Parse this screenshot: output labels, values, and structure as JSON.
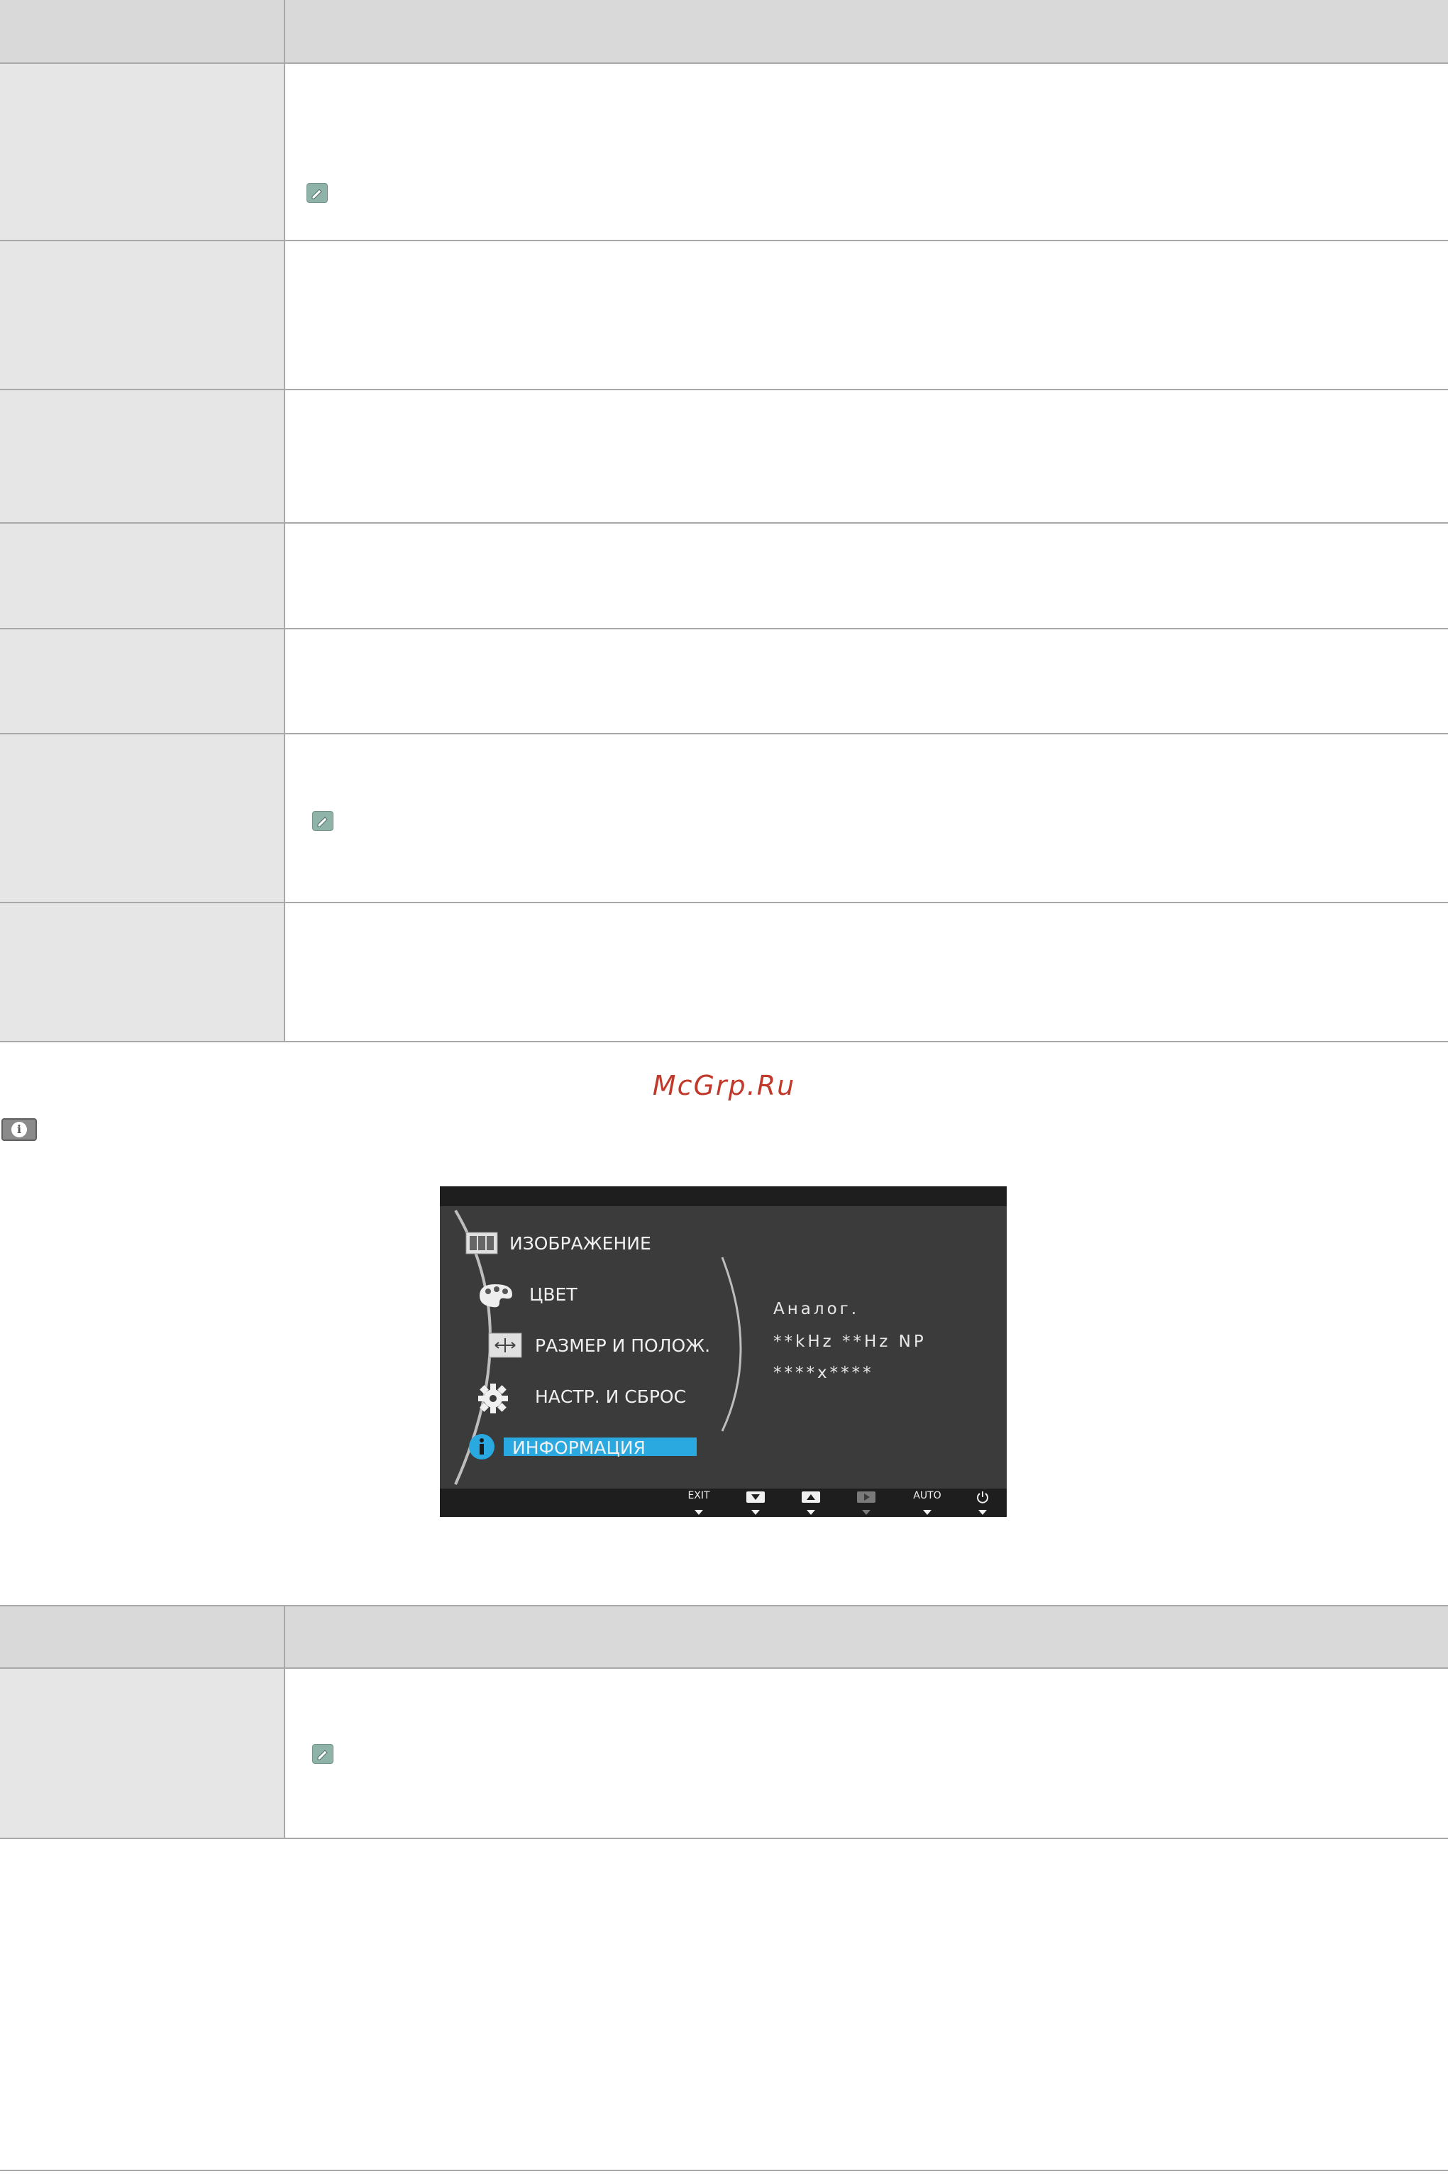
{
  "watermark": "McGrp.Ru",
  "osd": {
    "menu_items": [
      {
        "label": "ИЗОБРАЖЕНИЕ",
        "icon": "picture-icon"
      },
      {
        "label": "ЦВЕТ",
        "icon": "palette-icon"
      },
      {
        "label": "РАЗМЕР И ПОЛОЖ.",
        "icon": "size-position-icon"
      },
      {
        "label": "НАСТР. И СБРОС",
        "icon": "gear-icon"
      },
      {
        "label": "ИНФОРМАЦИЯ",
        "icon": "info-icon"
      }
    ],
    "selected_item": "ИНФОРМАЦИЯ",
    "info_lines": [
      "Аналог.",
      "**kHz **Hz NP",
      "****x****"
    ],
    "buttons": [
      {
        "label": "EXIT",
        "icon": "exit-icon"
      },
      {
        "label": "",
        "icon": "down-icon"
      },
      {
        "label": "",
        "icon": "up-icon"
      },
      {
        "label": "",
        "icon": "enter-icon"
      },
      {
        "label": "AUTO",
        "icon": "auto-icon"
      },
      {
        "label": "",
        "icon": "power-icon"
      }
    ],
    "colors": {
      "background": "#3b3b3b",
      "bar": "#1e1e1e",
      "highlight": "#29a9e0"
    }
  },
  "colors": {
    "left_cell": "#e6e6e6",
    "header_cell": "#d9d9d9",
    "rule": "#a8a8a8",
    "watermark": "#c0392b"
  }
}
